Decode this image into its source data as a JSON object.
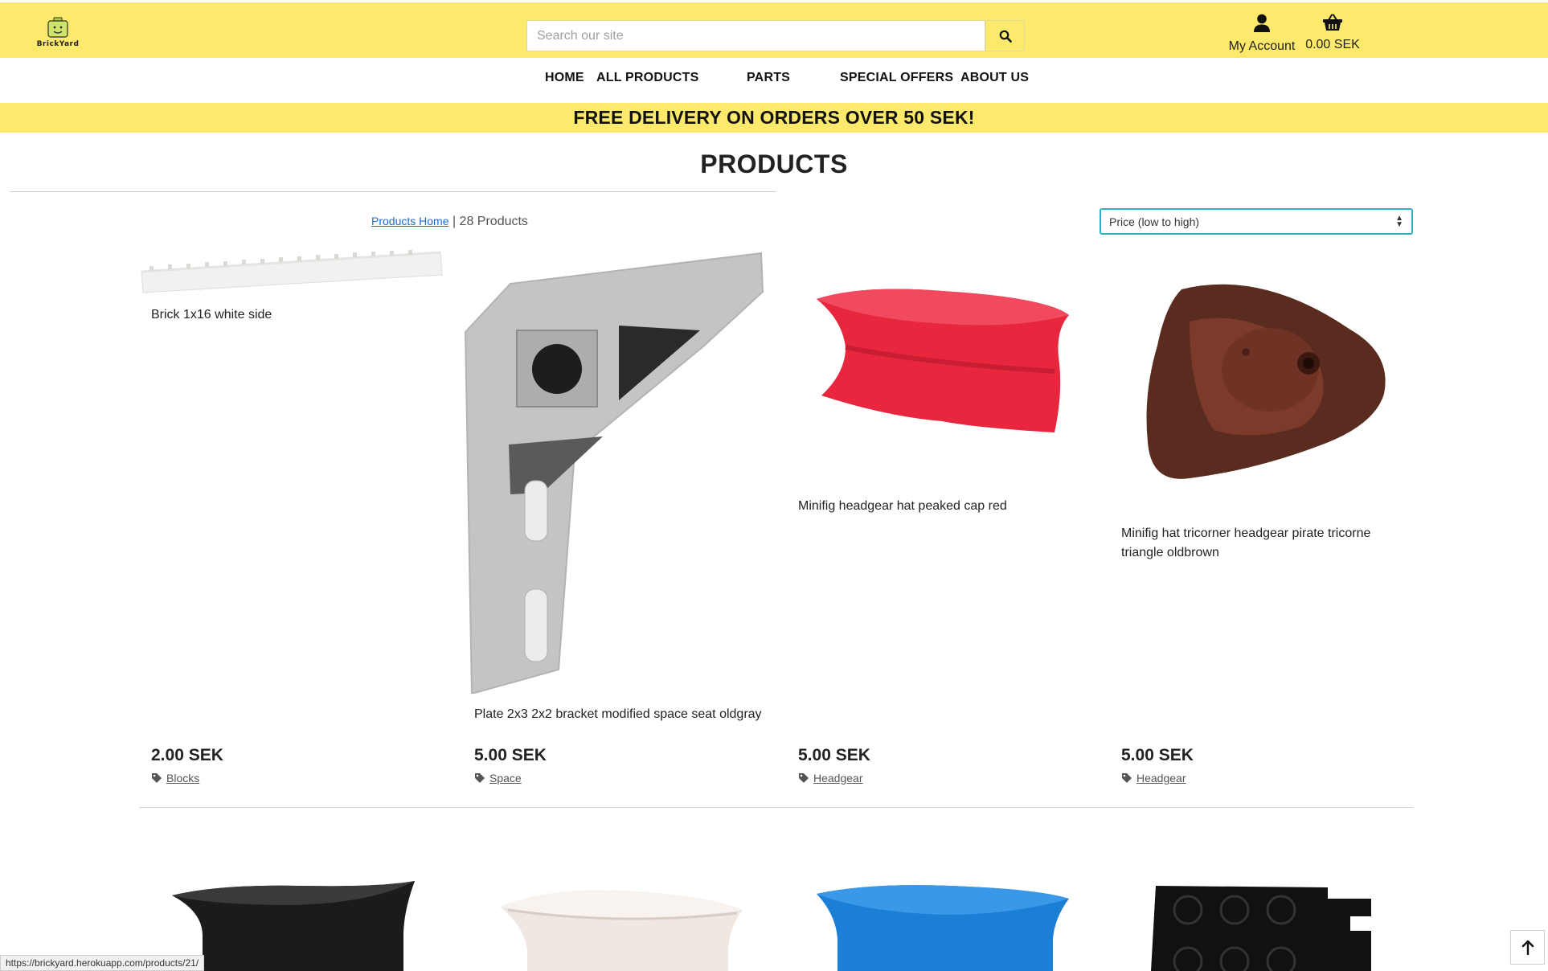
{
  "header": {
    "logo_text": "BrickYard",
    "search_placeholder": "Search our site",
    "account_label": "My Account",
    "cart_total": "0.00 SEK"
  },
  "nav": [
    "HOME",
    "ALL PRODUCTS",
    "PARTS",
    "SPECIAL OFFERS",
    "ABOUT US"
  ],
  "banner": "FREE DELIVERY ON ORDERS OVER 50 SEK!",
  "page_title": "PRODUCTS",
  "breadcrumb": {
    "link": "Products Home",
    "separator": "|",
    "count": "28 Products"
  },
  "sort": {
    "selected": "Price (low to high)"
  },
  "products": [
    {
      "name": "Brick 1x16 white side",
      "price": "2.00 SEK",
      "category": "Blocks"
    },
    {
      "name": "Plate 2x3 2x2 bracket modified space seat oldgray",
      "price": "5.00 SEK",
      "category": "Space"
    },
    {
      "name": "Minifig headgear hat peaked cap red",
      "price": "5.00 SEK",
      "category": "Headgear"
    },
    {
      "name": "Minifig hat tricorner headgear pirate tricorne triangle oldbrown",
      "price": "5.00 SEK",
      "category": "Headgear"
    }
  ],
  "status_url": "https://brickyard.herokuapp.com/products/21/",
  "colors": {
    "header_yellow": "#fde96c",
    "sort_border": "#31b2c7",
    "link_blue": "#1a6bd6"
  }
}
